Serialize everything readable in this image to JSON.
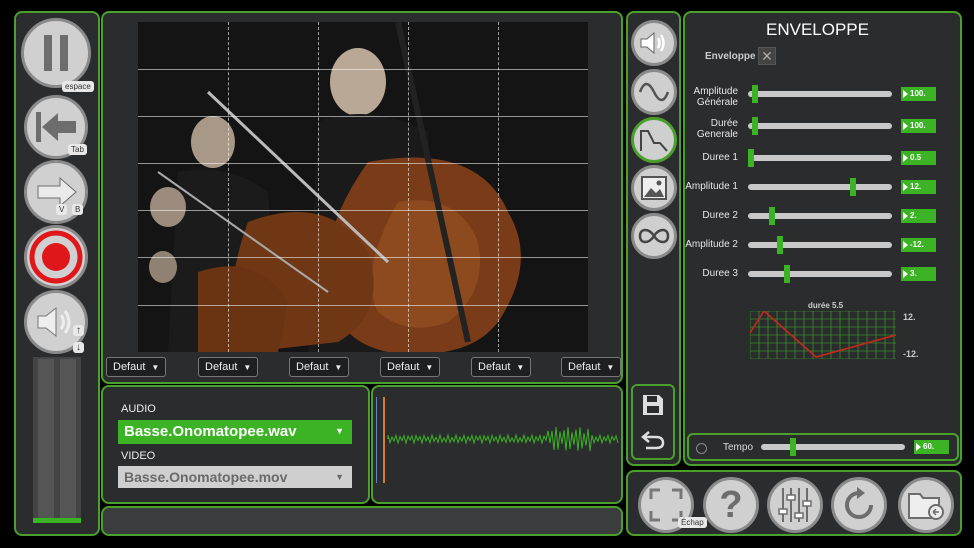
{
  "transport": {
    "pause_shortcut": "espace",
    "back_shortcut": "Tab",
    "forward_shortcut_v": "V",
    "forward_shortcut_b": "B",
    "volume_up": "↑",
    "volume_down": "↓",
    "level_fill": 0.05
  },
  "video": {
    "dropdowns": [
      "Defaut",
      "Defaut",
      "Defaut",
      "Defaut",
      "Defaut",
      "Defaut"
    ]
  },
  "media": {
    "audio_label": "AUDIO",
    "audio_file": "Basse.Onomatopee.wav",
    "video_label": "VIDEO",
    "video_file": "Basse.Onomatopee.mov"
  },
  "envelope": {
    "title": "ENVELOPPE",
    "toggle_label": "Enveloppe",
    "toggle_icon": "close-icon",
    "params": [
      {
        "label": "Amplitude Générale",
        "value": "100.",
        "pos": 0.05
      },
      {
        "label": "Durée Generale",
        "value": "100.",
        "pos": 0.05
      },
      {
        "label": "Duree 1",
        "value": "0.5",
        "pos": 0.02
      },
      {
        "label": "Amplitude 1",
        "value": "12.",
        "pos": 0.73
      },
      {
        "label": "Duree 2",
        "value": "2.",
        "pos": 0.17
      },
      {
        "label": "Amplitude 2",
        "value": "-12.",
        "pos": 0.22
      },
      {
        "label": "Duree 3",
        "value": "3.",
        "pos": 0.27
      }
    ],
    "graph_title": "durée 5.5",
    "graph_max": "12.",
    "graph_min": "-12.",
    "tempo_label": "Tempo",
    "tempo_value": "60.",
    "tempo_pos": 0.22
  },
  "bottom": {
    "fullscreen_shortcut": "Échap"
  },
  "colors": {
    "accent": "#4aa02a",
    "slider": "#3cb324",
    "panel": "#2a2c2e",
    "record": "#e0161b",
    "graph_line": "#c8281e"
  }
}
